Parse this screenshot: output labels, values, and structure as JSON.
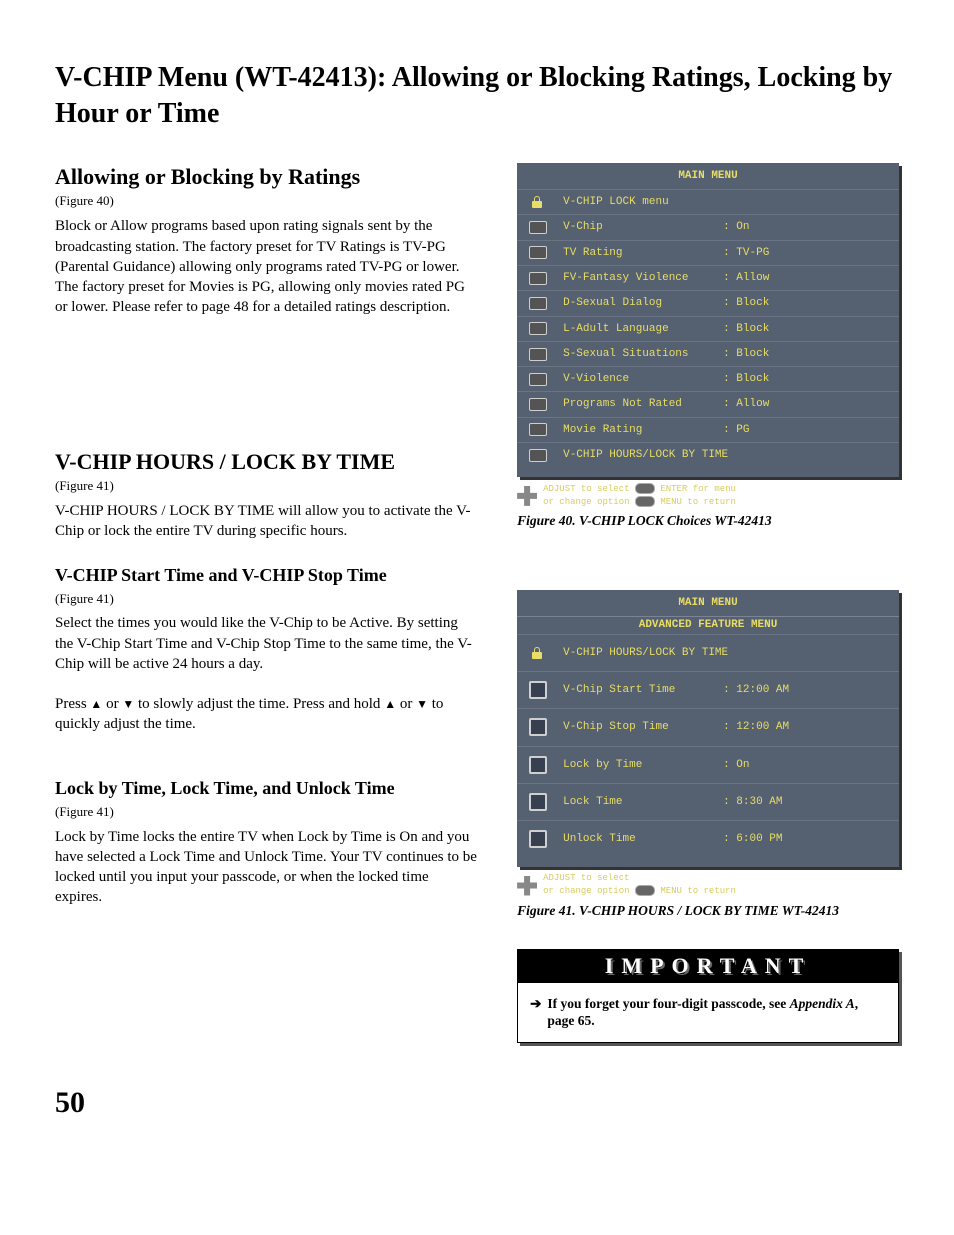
{
  "page_title": "V-CHIP Menu (WT-42413):  Allowing or Blocking Ratings, Locking by Hour or Time",
  "page_number": "50",
  "left": {
    "s1_heading": "Allowing or Blocking  by Ratings",
    "s1_fig": "(Figure 40)",
    "s1_body": "Block or Allow programs based upon rating signals sent by the broadcasting station.  The factory preset for TV Ratings is TV-PG (Parental Guidance) allowing only programs rated TV-PG or lower.  The factory preset for Movies is PG, allowing only movies rated PG or lower.  Please refer to page 48  for a detailed ratings description.",
    "s2_heading": "V-CHIP HOURS / LOCK BY TIME",
    "s2_fig": "(Figure 41)",
    "s2_body": "V-CHIP HOURS / LOCK BY TIME will allow you to activate the V-Chip or lock the entire TV during specific hours.",
    "s3_heading": "V-CHIP Start Time and V-CHIP Stop Time",
    "s3_fig": "(Figure 41)",
    "s3_body1": "Select the times you would like the V-Chip to be Active.  By setting the V-Chip Start Time and V-Chip Stop Time to the same time, the V-Chip will be active 24 hours a day.",
    "s3_body2_pre": "Press ",
    "s3_body2_mid": " or  ",
    "s3_body2_post1": " to slowly adjust the time.  Press and hold ",
    "s3_body2_post2": " or ",
    "s3_body2_end": " to quickly adjust the time.",
    "s4_heading": "Lock by Time, Lock Time, and Unlock Time",
    "s4_fig": "(Figure 41)",
    "s4_body": "Lock by Time locks the entire TV when Lock by Time is On and you have selected a Lock Time and Unlock Time.  Your TV continues to be locked until you input your passcode, or when the locked time expires."
  },
  "menu1": {
    "header": "MAIN MENU",
    "title": "V-CHIP LOCK menu",
    "rows": [
      {
        "label": "V-Chip",
        "value": ": On"
      },
      {
        "label": "TV Rating",
        "value": ": TV-PG"
      },
      {
        "label": "FV-Fantasy Violence",
        "value": ": Allow"
      },
      {
        "label": "D-Sexual Dialog",
        "value": ": Block"
      },
      {
        "label": "L-Adult Language",
        "value": ": Block"
      },
      {
        "label": "S-Sexual Situations",
        "value": ": Block"
      },
      {
        "label": "V-Violence",
        "value": ": Block"
      },
      {
        "label": "Programs Not Rated",
        "value": ": Allow"
      },
      {
        "label": "Movie Rating",
        "value": ": PG"
      },
      {
        "label": "V-CHIP HOURS/LOCK BY TIME",
        "value": ""
      }
    ],
    "hint1a": "ADJUST to select",
    "hint1b": "ENTER for menu",
    "hint2a": "or change option",
    "hint2b": "MENU to return",
    "caption": "Figure 40.  V-CHIP LOCK Choices WT-42413"
  },
  "menu2": {
    "header": "MAIN MENU",
    "subheader": "ADVANCED FEATURE MENU",
    "title": "V-CHIP HOURS/LOCK BY TIME",
    "rows": [
      {
        "label": "V-Chip Start Time",
        "value": ": 12:00 AM"
      },
      {
        "label": "V-Chip Stop Time",
        "value": ": 12:00 AM"
      },
      {
        "label": "Lock by Time",
        "value": ": On"
      },
      {
        "label": "Lock Time",
        "value": ": 8:30 AM"
      },
      {
        "label": "Unlock Time",
        "value": ": 6:00 PM"
      }
    ],
    "hint1": "ADJUST to select",
    "hint2a": "or change option",
    "hint2b": "MENU to return",
    "caption": "Figure 41.  V-CHIP HOURS / LOCK BY TIME WT-42413"
  },
  "important": {
    "header": "IMPORTANT",
    "body_pre": "If you forget your four-digit passcode, see ",
    "body_em": "Appendix A",
    "body_post": ", page 65."
  }
}
